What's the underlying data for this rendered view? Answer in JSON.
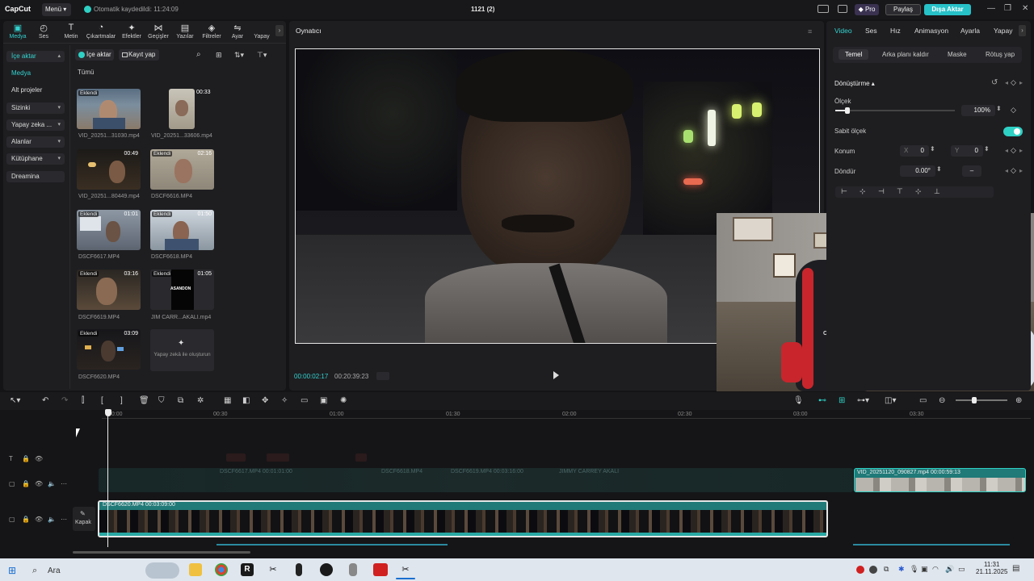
{
  "titlebar": {
    "logo": "CapCut",
    "menu": "Menü",
    "saved": "Otomatik kaydedildi: 11:24:09",
    "project": "1121 (2)",
    "pro": "Pro",
    "share": "Paylaş",
    "export": "Dışa Aktar"
  },
  "toolbar": {
    "tabs": [
      {
        "label": "Medya",
        "icon": "media-icon",
        "glyph": "▣"
      },
      {
        "label": "Ses",
        "icon": "audio-icon",
        "glyph": "◴"
      },
      {
        "label": "Metin",
        "icon": "text-icon",
        "glyph": "T"
      },
      {
        "label": "Çıkartmalar",
        "icon": "sticker-icon",
        "glyph": "◔"
      },
      {
        "label": "Efektler",
        "icon": "effects-icon",
        "glyph": "✦"
      },
      {
        "label": "Geçişler",
        "icon": "transition-icon",
        "glyph": "⋈"
      },
      {
        "label": "Yazılar",
        "icon": "captions-icon",
        "glyph": "▤"
      },
      {
        "label": "Filtreler",
        "icon": "filter-icon",
        "glyph": "◈"
      },
      {
        "label": "Ayar",
        "icon": "adjust-icon",
        "glyph": "⇋"
      },
      {
        "label": "Yapay",
        "icon": "ai-icon",
        "glyph": ""
      }
    ]
  },
  "sidebar": {
    "items": [
      {
        "label": "İçe aktar",
        "caret": "▴"
      },
      {
        "label": "Medya",
        "caret": ""
      },
      {
        "label": "Alt projeler",
        "caret": ""
      },
      {
        "label": "Sizinki",
        "caret": "▾"
      },
      {
        "label": "Yapay zeka ...",
        "caret": "▾"
      },
      {
        "label": "Alanlar",
        "caret": "▾"
      },
      {
        "label": "Kütüphane",
        "caret": "▾"
      },
      {
        "label": "Dreamina",
        "caret": ""
      }
    ]
  },
  "media": {
    "import": "İçe aktar",
    "record": "Kayıt yap",
    "filter_all": "Tümü",
    "added": "Eklendi",
    "items": [
      {
        "name": "VID_20251...31030.mp4",
        "duration": "",
        "added": true
      },
      {
        "name": "VID_20251...33606.mp4",
        "duration": "00:33",
        "added": false
      },
      {
        "name": "VID_20251...80449.mp4",
        "duration": "00:49",
        "added": false
      },
      {
        "name": "DSCF6616.MP4",
        "duration": "02:16",
        "added": true
      },
      {
        "name": "DSCF6617.MP4",
        "duration": "01:01",
        "added": true
      },
      {
        "name": "DSCF6618.MP4",
        "duration": "01:50",
        "added": true
      },
      {
        "name": "DSCF6619.MP4",
        "duration": "03:16",
        "added": true
      },
      {
        "name": "JIM CARR...AKALI.mp4",
        "duration": "01:05",
        "added": true
      },
      {
        "name": "DSCF6620.MP4",
        "duration": "03:09",
        "added": true
      }
    ],
    "thumb_text_asandon": "ASANDON",
    "ai_create": "Yapay zekâ ile oluşturun"
  },
  "player": {
    "title": "Oynatıcı",
    "current": "00:00:02:17",
    "total": "00:20:39:23"
  },
  "inspector": {
    "tabs": [
      "Video",
      "Ses",
      "Hız",
      "Animasyon",
      "Ayarla",
      "Yapay"
    ],
    "subtabs": [
      "Temel",
      "Arka planı kaldır",
      "Maske",
      "Rötuş yap"
    ],
    "transform": "Dönüştürme",
    "scale_label": "Ölçek",
    "scale_value": "100%",
    "scale_fraction": 0.1,
    "uniform_label": "Sabit ölçek",
    "position_label": "Konum",
    "pos_x_label": "X",
    "pos_x": "0",
    "pos_y_label": "Y",
    "pos_y": "0",
    "rotate_label": "Döndür",
    "rotate_value": "0.00°",
    "rotate_dash": "–"
  },
  "timeline": {
    "ruler": [
      "00:00",
      "00:30",
      "01:00",
      "01:30",
      "02:00",
      "02:30",
      "03:00",
      "03:30"
    ],
    "cover": "Kapak",
    "main_clip": "DSCF6620.MP4  00:03:09:00",
    "overlay_clip": "VID_20251120_090827.mp4  00:00:59:13",
    "overlay_faint": [
      "DSCF6617.MP4  00:01:01:00",
      "DSCF6618.MP4",
      "DSCF6619.MP4  00:03:16:00",
      "JIMMY CARREY AKALI"
    ]
  },
  "taskbar": {
    "search": "Ara",
    "time": "11:31",
    "date": "21.11.2025"
  },
  "colors": {
    "accent": "#2fd1c5",
    "clip_main": "#1f7a78",
    "panel": "#1e1e21"
  }
}
